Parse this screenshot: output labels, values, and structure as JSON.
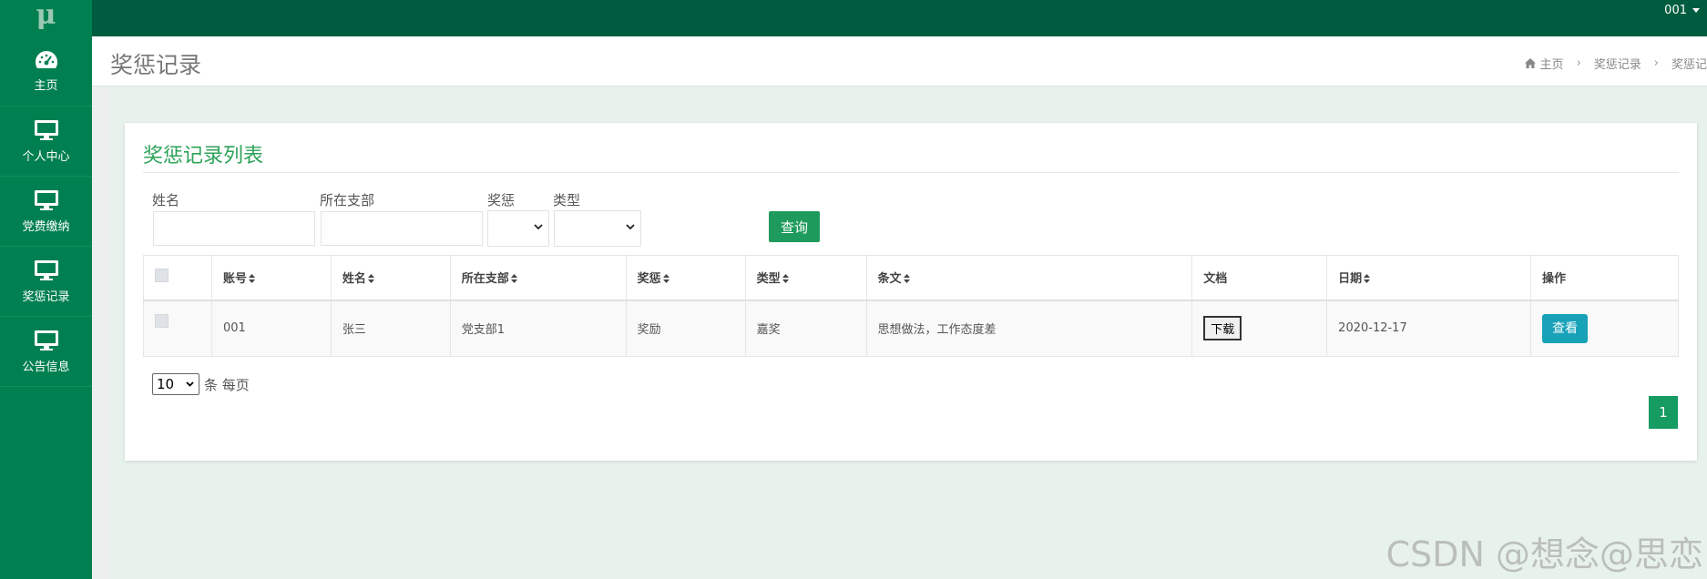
{
  "app": {
    "logo_text": "μ",
    "user": "001"
  },
  "sidebar": {
    "items": [
      {
        "label": "主页",
        "icon": "dashboard-icon"
      },
      {
        "label": "个人中心",
        "icon": "monitor-icon"
      },
      {
        "label": "党费缴纳",
        "icon": "monitor-icon"
      },
      {
        "label": "奖惩记录",
        "icon": "monitor-icon"
      },
      {
        "label": "公告信息",
        "icon": "monitor-icon"
      }
    ]
  },
  "header": {
    "title": "奖惩记录",
    "breadcrumb": [
      "主页",
      "奖惩记录",
      "奖惩记"
    ]
  },
  "card": {
    "title": "奖惩记录列表",
    "filters": {
      "name_label": "姓名",
      "name_value": "",
      "branch_label": "所在支部",
      "branch_value": "",
      "rp_label": "奖惩",
      "rp_value": "",
      "type_label": "类型",
      "type_value": "",
      "search_label": "查询"
    },
    "table": {
      "columns": [
        "账号",
        "姓名",
        "所在支部",
        "奖惩",
        "类型",
        "条文",
        "文档",
        "日期",
        "操作"
      ],
      "rows": [
        {
          "account": "001",
          "name": "张三",
          "branch": "党支部1",
          "reward_punish": "奖励",
          "type": "嘉奖",
          "clause": "思想做法，工作态度差",
          "doc_button": "下载",
          "date": "2020-12-17",
          "view_button": "查看"
        }
      ]
    },
    "pagination": {
      "page_size": "10",
      "suffix": "条 每页",
      "current_page": "1"
    }
  },
  "watermark": "CSDN @想念@思恋",
  "colors": {
    "topbar": "#005c3f",
    "sidebar": "#008050",
    "accent": "#2ea35a",
    "info": "#17a2b8"
  }
}
